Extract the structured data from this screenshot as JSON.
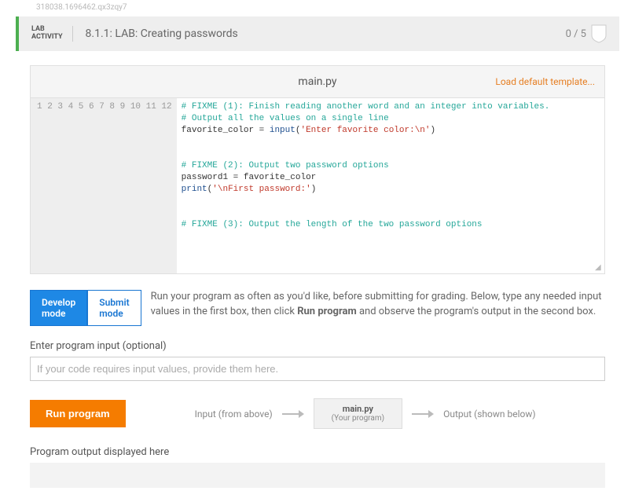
{
  "watermark": "318038.1696462.qx3zqy7",
  "header": {
    "label_line1": "LAB",
    "label_line2": "ACTIVITY",
    "title": "8.1.1: LAB: Creating passwords",
    "score": "0 / 5"
  },
  "editor": {
    "filename": "main.py",
    "load_template": "Load default template...",
    "gutter": [
      "1",
      "2",
      "3",
      "4",
      "5",
      "6",
      "7",
      "8",
      "9",
      "10",
      "11",
      "12"
    ],
    "code": [
      {
        "type": "comment",
        "text": "# FIXME (1): Finish reading another word and an integer into variables."
      },
      {
        "type": "comment",
        "text": "# Output all the values on a single line"
      },
      {
        "type": "assign_input",
        "lhs": "favorite_color = ",
        "fn": "input",
        "open": "(",
        "str": "'Enter favorite color:\\n'",
        "close": ")"
      },
      {
        "type": "blank",
        "text": ""
      },
      {
        "type": "blank",
        "text": ""
      },
      {
        "type": "comment",
        "text": "# FIXME (2): Output two password options"
      },
      {
        "type": "plain",
        "text": "password1 = favorite_color"
      },
      {
        "type": "print",
        "fn": "print",
        "open": "(",
        "str": "'\\nFirst password:'",
        "close": ")"
      },
      {
        "type": "blank",
        "text": ""
      },
      {
        "type": "blank",
        "text": ""
      },
      {
        "type": "comment",
        "text": "# FIXME (3): Output the length of the two password options"
      },
      {
        "type": "blank",
        "text": ""
      }
    ]
  },
  "modes": {
    "develop": "Develop mode",
    "submit": "Submit mode",
    "description_a": "Run your program as often as you'd like, before submitting for grading. Below, type any needed input values in the first box, then click ",
    "description_bold": "Run program",
    "description_b": " and observe the program's output in the second box."
  },
  "input": {
    "label": "Enter program input (optional)",
    "placeholder": "If your code requires input values, provide them here."
  },
  "run": {
    "button": "Run program",
    "input_label": "Input (from above)",
    "program_title": "main.py",
    "program_sub": "(Your program)",
    "output_label": "Output (shown below)"
  },
  "output": {
    "label": "Program output displayed here"
  }
}
